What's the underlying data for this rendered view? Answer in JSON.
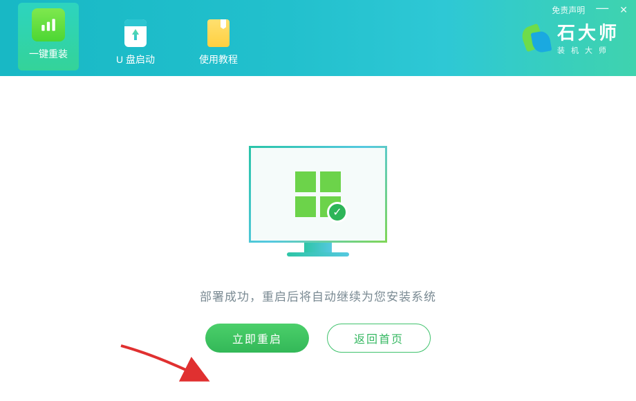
{
  "header": {
    "tabs": [
      {
        "label": "一键重装",
        "icon": "reinstall"
      },
      {
        "label": "U 盘启动",
        "icon": "usb"
      },
      {
        "label": "使用教程",
        "icon": "tutorial"
      }
    ],
    "disclaimer": "免责声明",
    "brand_title": "石大师",
    "brand_sub": "装机大师"
  },
  "content": {
    "status_text": "部署成功，重启后将自动继续为您安装系统",
    "restart_label": "立即重启",
    "home_label": "返回首页"
  }
}
